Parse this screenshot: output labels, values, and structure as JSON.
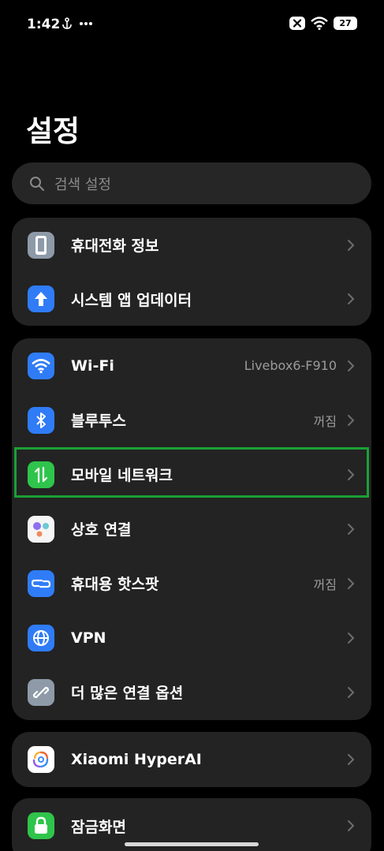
{
  "status_bar": {
    "time": "1:42",
    "left_icons": [
      "anchor-icon",
      "more-dots-icon"
    ],
    "right_icons": [
      "close-box-icon",
      "wifi-icon"
    ],
    "battery": "27"
  },
  "page": {
    "title": "설정"
  },
  "search": {
    "placeholder": "검색 설정"
  },
  "groups": [
    {
      "items": [
        {
          "label": "휴대전화 정보",
          "icon": "phone-icon",
          "icon_color": "#8e9aa8"
        },
        {
          "label": "시스템 앱 업데이터",
          "icon": "arrow-up-icon",
          "icon_color": "#2f7cf6"
        }
      ]
    },
    {
      "items": [
        {
          "label": "Wi-Fi",
          "value": "Livebox6-F910",
          "icon": "wifi-icon",
          "icon_color": "#2f7cf6"
        },
        {
          "label": "블루투스",
          "value": "꺼짐",
          "icon": "bluetooth-icon",
          "icon_color": "#2f7cf6"
        },
        {
          "label": "모바일 네트워크",
          "icon": "mobile-data-icon",
          "icon_color": "#2fc44b"
        },
        {
          "label": "상호 연결",
          "icon": "interconnect-icon",
          "icon_color": "#f5f5f5"
        },
        {
          "label": "휴대용 핫스팟",
          "value": "꺼짐",
          "icon": "hotspot-icon",
          "icon_color": "#2f7cf6"
        },
        {
          "label": "VPN",
          "icon": "globe-icon",
          "icon_color": "#2f7cf6"
        },
        {
          "label": "더 많은 연결 옵션",
          "icon": "link-icon",
          "icon_color": "#8e9aa8"
        }
      ]
    },
    {
      "items": [
        {
          "label": "Xiaomi HyperAI",
          "icon": "hyperai-icon",
          "icon_color": "#ffffff"
        }
      ]
    },
    {
      "items": [
        {
          "label": "잠금화면",
          "icon": "lock-icon",
          "icon_color": "#2fc44b"
        }
      ]
    }
  ],
  "highlight_color": "#1aa035"
}
